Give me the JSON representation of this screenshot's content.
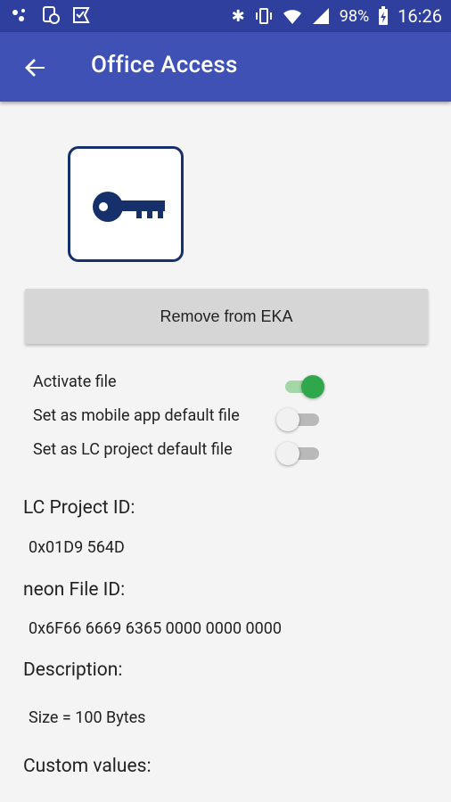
{
  "status_bar": {
    "battery": "98%",
    "time": "16:26"
  },
  "app_bar": {
    "title": "Office Access"
  },
  "actions": {
    "remove_label": "Remove from EKA"
  },
  "options": [
    {
      "label": "Activate file",
      "on": true
    },
    {
      "label": "Set as mobile app default file",
      "on": false
    },
    {
      "label": "Set as LC project default file",
      "on": false
    }
  ],
  "details": {
    "lc_project_id_label": "LC Project ID:",
    "lc_project_id": "0x01D9 564D",
    "neon_file_id_label": "neon File ID:",
    "neon_file_id": "0x6F66 6669 6365 0000 0000 0000",
    "description_label": "Description:",
    "description": "Size = 100 Bytes",
    "custom_values_label": "Custom values:"
  },
  "colors": {
    "primary": "#3f51b5",
    "status_bar": "#2f3f9e",
    "key": "#16306b",
    "switch_on": "#2ea84a"
  }
}
